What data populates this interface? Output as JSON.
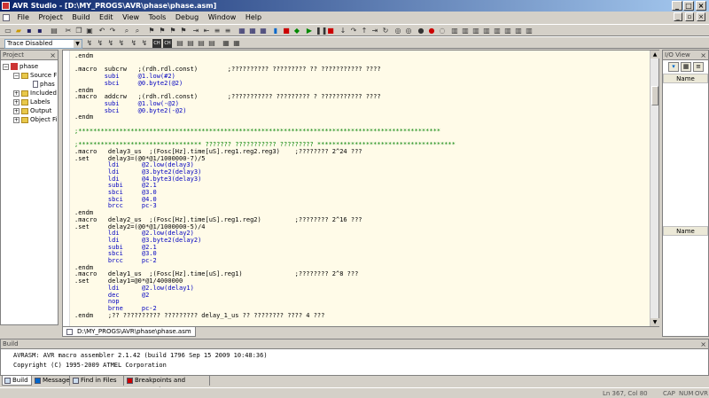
{
  "window": {
    "title": "AVR Studio - [D:\\MY_PROGS\\AVR\\phase\\phase.asm]"
  },
  "menu": [
    "File",
    "Project",
    "Build",
    "Edit",
    "View",
    "Tools",
    "Debug",
    "Window",
    "Help"
  ],
  "toolbar": {
    "trace_select": "Trace Disabled"
  },
  "project": {
    "header": "Project",
    "items": [
      "phase",
      "Source F",
      "phas",
      "Included",
      "Labels",
      "Output",
      "Object Fi"
    ]
  },
  "editor": {
    "tab": "D:\\MY_PROGS\\AVR\\phase\\phase.asm",
    "lines": [
      ".endm",
      "",
      ".macro  subcrw   ;(rdh.rdl.const)        ;?????????? ????????? ?? ??????????? ????",
      "        subi     @1.low(#2)",
      "        sbci     @0.byte2(@2)",
      ".endm",
      ".macro  addcrw   ;(rdh.rdl.const)        ;??????????? ????????? ? ??????????? ????",
      "        subi     @1.low(-@2)",
      "        sbci     @0.byte2(-@2)",
      ".endm",
      "",
      ";*************************************************************************************************",
      "",
      ";********************************* ??????? ??????????? ????????? *************************************",
      ".macro   delay3_us  ;(Fosc[Hz].time[uS].reg1.reg2.reg3)    ;???????? 2^24 ???",
      ".set     delay3=(@0*@1/1000000-7)/5",
      "         ldi      @2.low(delay3)",
      "         ldi      @3.byte2(delay3)",
      "         ldi      @4.byte3(delay3)",
      "         subi     @2.1",
      "         sbci     @3.0",
      "         sbci     @4.0",
      "         brcc     pc-3",
      ".endm",
      ".macro   delay2_us  ;(Fosc[Hz].time[uS].reg1.reg2)         ;???????? 2^16 ???",
      ".set     delay2=(@0*@1/1000000-5)/4",
      "         ldi      @2.low(delay2)",
      "         ldi      @3.byte2(delay2)",
      "         subi     @2.1",
      "         sbci     @3.0",
      "         brcc     pc-2",
      ".endm",
      ".macro   delay1_us  ;(Fosc[Hz].time[uS].reg1)              ;???????? 2^8 ???",
      ".set     delay1=@0*@1/4000000",
      "         ldi      @2.low(delay1)",
      "         dec      @2",
      "         nop",
      "         brne     pc-2",
      ".endm    ;?? ?????????? ????????? delay_1_us ?? ???????? ???? 4 ???"
    ]
  },
  "io_view": {
    "header": "I/O View",
    "col1": "Name",
    "col2": "Name"
  },
  "build": {
    "header": "Build",
    "lines": [
      "AVRASM: AVR macro assembler 2.1.42 (build 1796 Sep 15 2009 10:48:36)",
      "Copyright (C) 1995-2009 ATMEL Corporation"
    ],
    "tabs": [
      "Build",
      "Message",
      "Find in Files",
      "Breakpoints and Tracepoints"
    ]
  },
  "status": {
    "pos": "Ln 367, Col 80",
    "cap": "CAP",
    "num": "NUM",
    "ovr": "OVR"
  }
}
